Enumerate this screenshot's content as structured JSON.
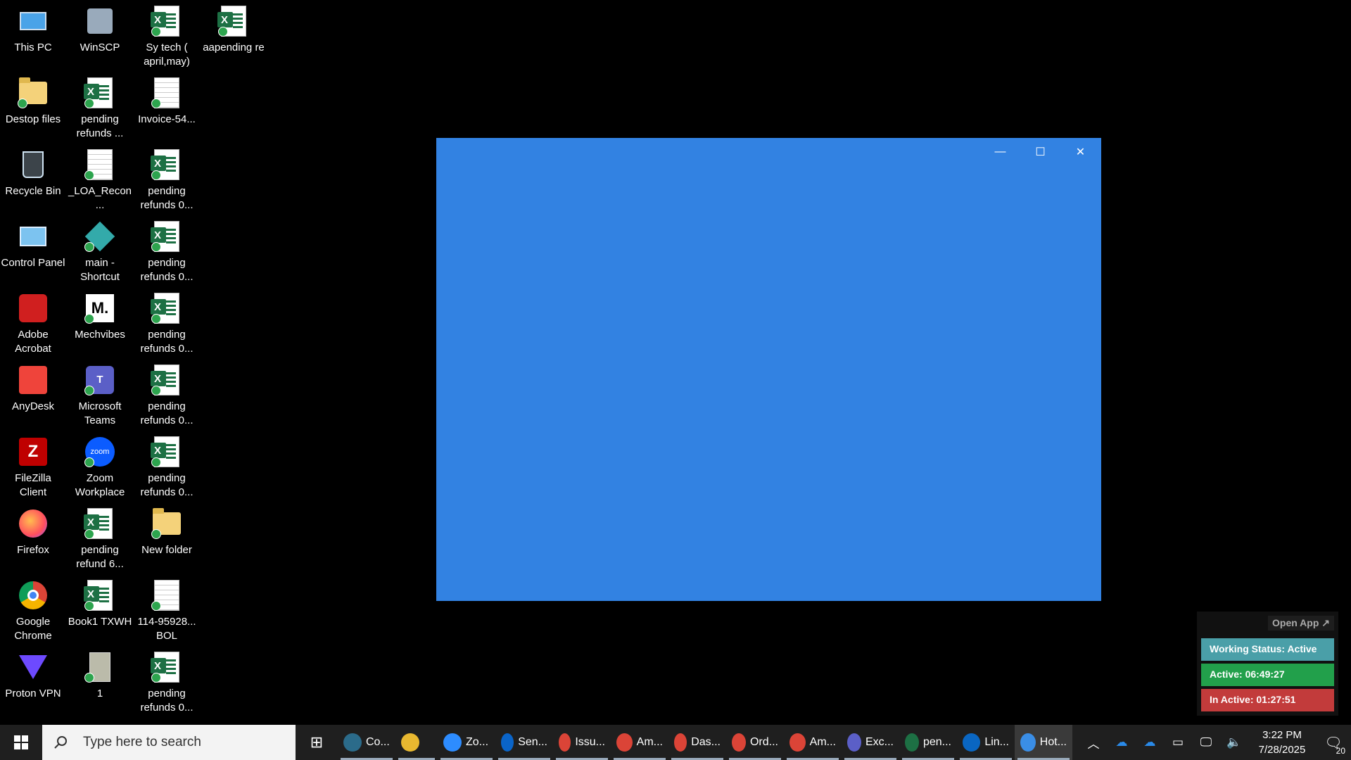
{
  "desktop": {
    "icons": [
      {
        "label": "This PC",
        "icon": "this-pc-icon"
      },
      {
        "label": "Destop files",
        "icon": "folder-icon"
      },
      {
        "label": "Recycle Bin",
        "icon": "recycle-bin-icon"
      },
      {
        "label": "Control Panel",
        "icon": "control-panel-icon"
      },
      {
        "label": "Adobe Acrobat",
        "icon": "adobe-acrobat-icon"
      },
      {
        "label": "AnyDesk",
        "icon": "anydesk-icon"
      },
      {
        "label": "FileZilla Client",
        "icon": "filezilla-icon"
      },
      {
        "label": "Firefox",
        "icon": "firefox-icon"
      },
      {
        "label": "Google Chrome",
        "icon": "chrome-icon"
      },
      {
        "label": "Proton VPN",
        "icon": "proton-vpn-icon"
      },
      {
        "label": "WinSCP",
        "icon": "winscp-icon"
      },
      {
        "label": "pending refunds ...",
        "icon": "excel-file-icon"
      },
      {
        "label": "_LOA_Recon...",
        "icon": "document-icon"
      },
      {
        "label": "main - Shortcut",
        "icon": "shortcut-icon"
      },
      {
        "label": "Mechvibes",
        "icon": "mechvibes-icon"
      },
      {
        "label": "Microsoft Teams",
        "icon": "teams-icon"
      },
      {
        "label": "Zoom Workplace",
        "icon": "zoom-icon"
      },
      {
        "label": "pending refund 6...",
        "icon": "excel-file-icon"
      },
      {
        "label": "Book1 TXWH",
        "icon": "excel-file-icon"
      },
      {
        "label": "1",
        "icon": "image-file-icon"
      },
      {
        "label": "Sy tech ( april,may)",
        "icon": "excel-file-icon"
      },
      {
        "label": "Invoice-54...",
        "icon": "document-icon"
      },
      {
        "label": "pending refunds 0...",
        "icon": "excel-file-icon"
      },
      {
        "label": "pending refunds 0...",
        "icon": "excel-file-icon"
      },
      {
        "label": "pending refunds 0...",
        "icon": "excel-file-icon"
      },
      {
        "label": "pending refunds 0...",
        "icon": "excel-file-icon"
      },
      {
        "label": "pending refunds 0...",
        "icon": "excel-file-icon"
      },
      {
        "label": "New folder",
        "icon": "folder-icon"
      },
      {
        "label": "114-95928... BOL",
        "icon": "document-icon"
      },
      {
        "label": "pending refunds 0...",
        "icon": "excel-file-icon"
      },
      {
        "label": "aapending re",
        "icon": "excel-file-icon"
      }
    ]
  },
  "window": {
    "background": "#3282e2",
    "minimize_glyph": "—",
    "maximize_glyph": "☐",
    "close_glyph": "✕"
  },
  "widget": {
    "open_app": "Open App ↗",
    "working_status": "Working Status: Active",
    "active": "Active: 06:49:27",
    "inactive": "In Active: 01:27:51",
    "colors": {
      "status": "#4a9fa8",
      "active": "#22a04b",
      "inactive": "#c23b3b"
    }
  },
  "taskbar": {
    "search_placeholder": "Type here to search",
    "apps": [
      {
        "label": "Co...",
        "icon": "copilot-icon",
        "color": "#2b6b8a"
      },
      {
        "label": "",
        "icon": "file-explorer-icon",
        "color": "#e8b830"
      },
      {
        "label": "Zo...",
        "icon": "zoom-icon",
        "color": "#2d8cff"
      },
      {
        "label": "Sen...",
        "icon": "outlook-icon",
        "color": "#0a64c8"
      },
      {
        "label": "Issu...",
        "icon": "chrome-icon",
        "color": "#db4437"
      },
      {
        "label": "Am...",
        "icon": "chrome-icon",
        "color": "#db4437"
      },
      {
        "label": "Das...",
        "icon": "chrome-icon",
        "color": "#db4437"
      },
      {
        "label": "Ord...",
        "icon": "chrome-icon",
        "color": "#db4437"
      },
      {
        "label": "Am...",
        "icon": "chrome-icon",
        "color": "#db4437"
      },
      {
        "label": "Exc...",
        "icon": "teams-icon",
        "color": "#5b5fc7"
      },
      {
        "label": "pen...",
        "icon": "excel-icon",
        "color": "#1d7044"
      },
      {
        "label": "Lin...",
        "icon": "linkedin-icon",
        "color": "#0a66c2"
      },
      {
        "label": "Hot...",
        "icon": "shield-icon",
        "color": "#3a8ee6"
      }
    ],
    "time": "3:22 PM",
    "date": "7/28/2025",
    "notification_count": "20"
  }
}
